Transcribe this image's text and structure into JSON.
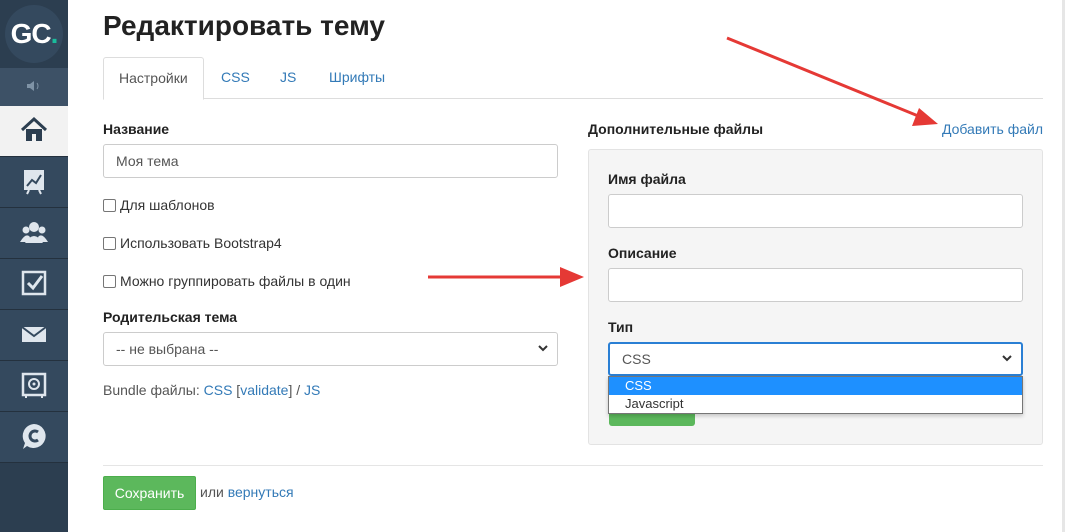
{
  "sidebar": {
    "logo_main": "GC",
    "logo_dot": ".",
    "collapse_icon": "◄)",
    "items": [
      {
        "icon": "home-icon"
      },
      {
        "icon": "chart-icon"
      },
      {
        "icon": "users-icon"
      },
      {
        "icon": "checkbox-icon"
      },
      {
        "icon": "mail-icon"
      },
      {
        "icon": "safe-icon"
      },
      {
        "icon": "chat-c-icon"
      }
    ]
  },
  "page": {
    "title": "Редактировать тему",
    "tabs": [
      "Настройки",
      "CSS",
      "JS",
      "Шрифты"
    ]
  },
  "form": {
    "name_label": "Название",
    "name_value": "Моя тема",
    "checkbox_templates": "Для шаблонов",
    "checkbox_bootstrap": "Использовать Bootstrap4",
    "checkbox_group": "Можно группировать файлы в один",
    "parent_label": "Родительская тема",
    "parent_value": "-- не выбрана --",
    "bundle_prefix": "Bundle файлы: ",
    "bundle_css": "CSS",
    "bundle_open": " [",
    "bundle_validate": "validate",
    "bundle_close": "] / ",
    "bundle_js": "JS"
  },
  "extra": {
    "label": "Дополнительные файлы",
    "add_link": "Добавить файл",
    "filename_label": "Имя файла",
    "filename_value": "",
    "desc_label": "Описание",
    "desc_value": "",
    "type_label": "Тип",
    "type_value": "CSS",
    "type_options": [
      "CSS",
      "Javascript"
    ]
  },
  "footer": {
    "save_label": "Сохранить",
    "or_text": "или ",
    "back_link": "вернуться"
  },
  "colors": {
    "sidebar": "#2c3e50",
    "accent_link": "#337ab7",
    "save_green": "#5cb85c",
    "annotation_arrow": "#e53935",
    "option_highlight": "#1e90ff"
  }
}
